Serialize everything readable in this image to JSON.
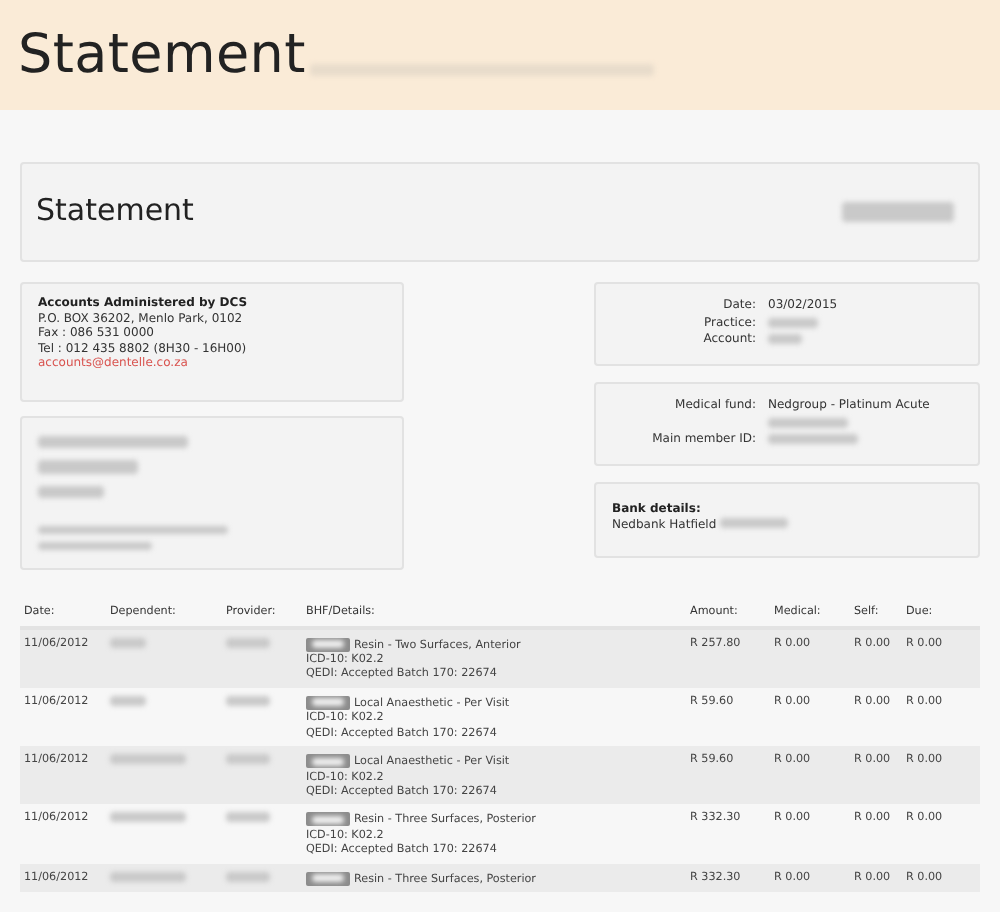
{
  "header": {
    "title": "Statement",
    "subtitle": {
      "redacted": true
    }
  },
  "statement_card": {
    "title": "Statement",
    "reference": {
      "redacted": true
    }
  },
  "administrator": {
    "name": "Accounts Administered by DCS",
    "lines": [
      "P.O. BOX 36202, Menlo Park, 0102",
      "Fax : 086 531 0000",
      "Tel : 012 435 8802 (8H30 - 16H00)"
    ],
    "email": "accounts@dentelle.co.za"
  },
  "recipient": {
    "lines": [
      {
        "kind": "heading",
        "redacted": true
      },
      {
        "kind": "heading",
        "redacted": true
      },
      {
        "kind": "heading",
        "redacted": true
      },
      {
        "kind": "contact",
        "redacted": true
      },
      {
        "kind": "contact",
        "redacted": true
      }
    ]
  },
  "statement_info": [
    {
      "label": "Date:",
      "value": "03/02/2015"
    },
    {
      "label": "Practice:",
      "redacted": true
    },
    {
      "label": "Account:",
      "redacted": true
    }
  ],
  "fund_info": [
    {
      "label": "Medical fund:",
      "value": "Nedgroup - Platinum Acute"
    },
    {
      "redacted": true
    },
    {
      "label": "Main member ID:",
      "redacted": true
    }
  ],
  "bank": {
    "label": "Bank details:",
    "value": "Nedbank Hatfield",
    "account": {
      "redacted": true
    }
  },
  "table": {
    "columns": [
      "Date:",
      "Dependent:",
      "Provider:",
      "BHF/Details:",
      "Amount:",
      "Medical:",
      "Self:",
      "Due:"
    ],
    "rows": [
      {
        "date": "11/06/2012",
        "dependent": {
          "redacted": true
        },
        "provider": {
          "redacted": true
        },
        "code": {
          "redacted": true
        },
        "details": [
          "Resin - Two Surfaces, Anterior",
          "ICD-10: K02.2",
          "QEDI: Accepted Batch 170: 22674"
        ],
        "amount": "R 257.80",
        "medical": "R 0.00",
        "self": "R 0.00",
        "due": "R 0.00"
      },
      {
        "date": "11/06/2012",
        "dependent": {
          "redacted": true
        },
        "provider": {
          "redacted": true
        },
        "code": {
          "redacted": true
        },
        "details": [
          "Local Anaesthetic - Per Visit",
          "ICD-10: K02.2",
          "QEDI: Accepted Batch 170: 22674"
        ],
        "amount": "R 59.60",
        "medical": "R 0.00",
        "self": "R 0.00",
        "due": "R 0.00"
      },
      {
        "date": "11/06/2012",
        "dependent": {
          "redacted": true
        },
        "provider": {
          "redacted": true
        },
        "code": {
          "redacted": true
        },
        "details": [
          "Local Anaesthetic - Per Visit",
          "ICD-10: K02.2",
          "QEDI: Accepted Batch 170: 22674"
        ],
        "amount": "R 59.60",
        "medical": "R 0.00",
        "self": "R 0.00",
        "due": "R 0.00"
      },
      {
        "date": "11/06/2012",
        "dependent": {
          "redacted": true
        },
        "provider": {
          "redacted": true
        },
        "code": {
          "redacted": true
        },
        "details": [
          "Resin - Three Surfaces, Posterior",
          "ICD-10: K02.2",
          "QEDI: Accepted Batch 170: 22674"
        ],
        "amount": "R 332.30",
        "medical": "R 0.00",
        "self": "R 0.00",
        "due": "R 0.00"
      },
      {
        "date": "11/06/2012",
        "dependent": {
          "redacted": true
        },
        "provider": {
          "redacted": true
        },
        "code": {
          "redacted": true
        },
        "details": [
          "Resin - Three Surfaces, Posterior"
        ],
        "amount": "R 332.30",
        "medical": "R 0.00",
        "self": "R 0.00",
        "due": "R 0.00"
      }
    ]
  }
}
